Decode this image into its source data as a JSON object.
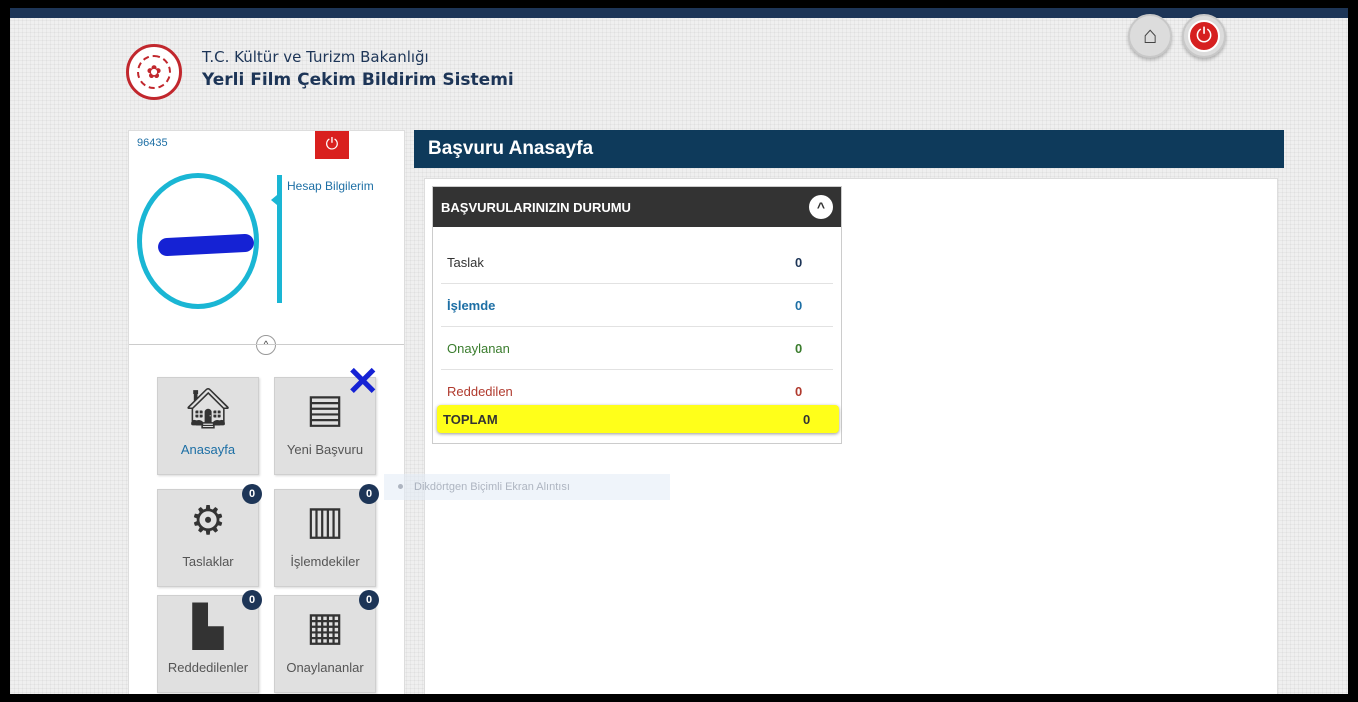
{
  "header": {
    "ministry": "T.C. Kültür ve Turizm Bakanlığı",
    "system_name": "Yerli Film Çekim Bildirim Sistemi"
  },
  "sidebar": {
    "user_id": "96435",
    "account_link": "Hesap Bilgilerim",
    "tiles": [
      {
        "label": "Anasayfa",
        "icon": "home-icon"
      },
      {
        "label": "Yeni Başvuru",
        "icon": "notepad-icon"
      },
      {
        "label": "Taslaklar",
        "icon": "gears-icon",
        "badge": "0"
      },
      {
        "label": "İşlemdekiler",
        "icon": "binders-icon",
        "badge": "0"
      },
      {
        "label": "Reddedilenler",
        "icon": "report-icon",
        "badge": "0"
      },
      {
        "label": "Onaylananlar",
        "icon": "archive-icon",
        "badge": "0"
      }
    ]
  },
  "main": {
    "title": "Başvuru Anasayfa",
    "panel": {
      "title": "BAŞVURULARINIZIN DURUMU",
      "rows": [
        {
          "label": "Taslak",
          "value": "0",
          "color": "#333333"
        },
        {
          "label": "İşlemde",
          "value": "0",
          "color": "#1d6fa5"
        },
        {
          "label": "Onaylanan",
          "value": "0",
          "color": "#3b7d2e"
        },
        {
          "label": "Reddedilen",
          "value": "0",
          "color": "#b03a2e"
        }
      ],
      "total": {
        "label": "TOPLAM",
        "value": "0"
      }
    }
  },
  "tooltip": "Dikdörtgen Biçimli Ekran Alıntısı",
  "colors": {
    "brand": "#0e3a5b",
    "accent": "#1ab6d4",
    "danger": "#d9201e",
    "highlight": "#ffff1a"
  }
}
